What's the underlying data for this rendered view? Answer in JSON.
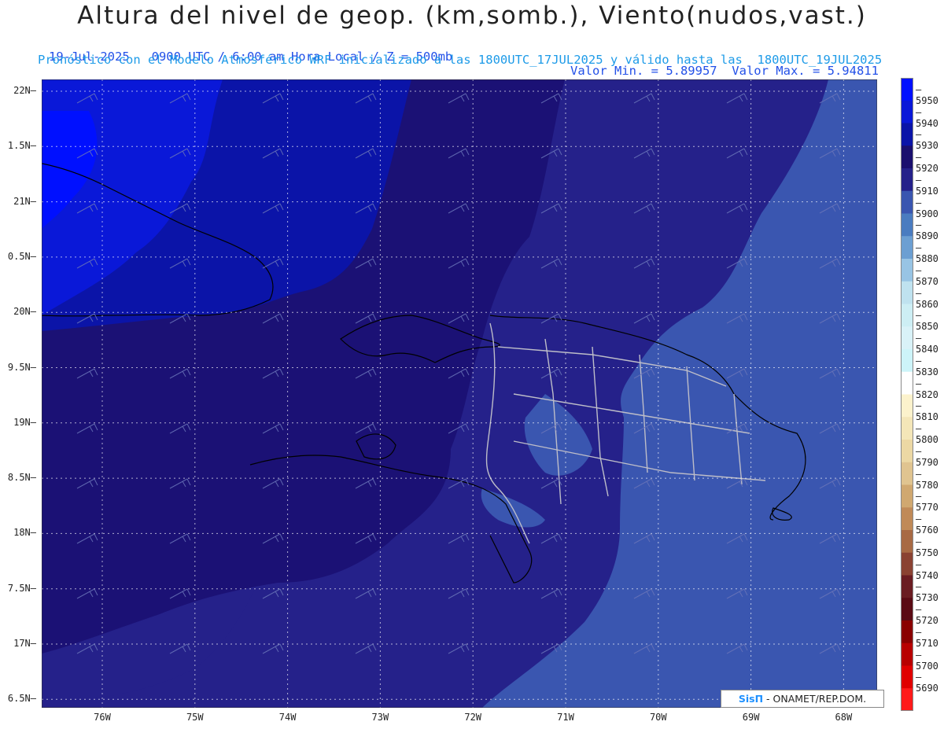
{
  "header": {
    "title": "Altura del nivel de geop. (km,somb.), Viento(nudos,vast.)",
    "datetime": "19-Jul-2025   0900 UTC / 6:00 am Hora Local / Z = 500mb",
    "minmax": "Valor Min. = 5.89957  Valor Max. = 5.94811",
    "model_info": "Pronóstico con el Modelo Atmosférico WRF inicializado a las 1800UTC_17JUL2025 y válido hasta las  1800UTC_19JUL2025"
  },
  "axes": {
    "lat_labels": [
      "22N",
      "1.5N",
      "21N",
      "0.5N",
      "20N",
      "9.5N",
      "19N",
      "8.5N",
      "18N",
      "7.5N",
      "17N",
      "6.5N"
    ],
    "lon_labels": [
      "76W",
      "75W",
      "74W",
      "73W",
      "72W",
      "71W",
      "70W",
      "69W",
      "68W"
    ]
  },
  "colorbar": {
    "labels": [
      "5950",
      "5940",
      "5930",
      "5920",
      "5910",
      "5900",
      "5890",
      "5880",
      "5870",
      "5860",
      "5850",
      "5840",
      "5830",
      "5820",
      "5810",
      "5800",
      "5790",
      "5780",
      "5770",
      "5760",
      "5750",
      "5740",
      "5730",
      "5720",
      "5710",
      "5700",
      "5690"
    ],
    "colors": [
      "#0010ff",
      "#0a18d8",
      "#0b14a8",
      "#1a0f6e",
      "#25218a",
      "#3a56b0",
      "#4a7cc0",
      "#6c9fd2",
      "#98c4e4",
      "#bfe2ef",
      "#cdeef4",
      "#d9f2f8",
      "#cdf4f9",
      "#ffffff",
      "#fcf2cc",
      "#f4e6b8",
      "#ecd8a4",
      "#e0c490",
      "#d0a870",
      "#c08a58",
      "#a86a44",
      "#8a4232",
      "#6a1c22",
      "#5a0a14",
      "#8a0000",
      "#b80000",
      "#e00000",
      "#ff1a1a"
    ]
  },
  "credit": {
    "logo": "SisΠ",
    "text": "- ONAMET/REP.DOM."
  }
}
